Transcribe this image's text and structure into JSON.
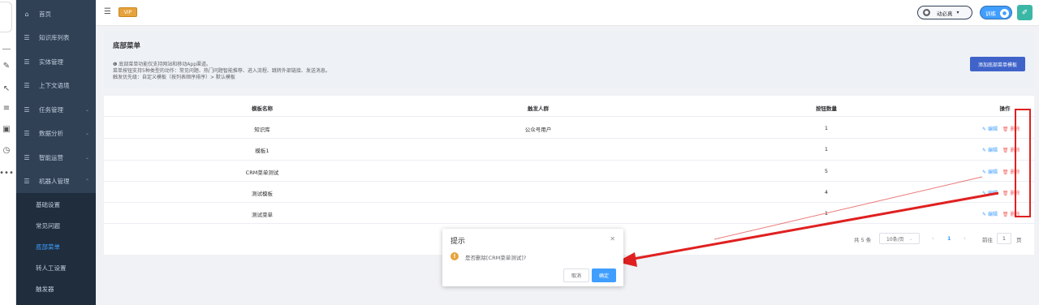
{
  "sidebar": {
    "items": [
      {
        "label": "首页",
        "icon": "home-icon",
        "arrow": ""
      },
      {
        "label": "知识库列表",
        "icon": "list-icon",
        "arrow": ""
      },
      {
        "label": "实体管理",
        "icon": "list-icon",
        "arrow": ""
      },
      {
        "label": "上下文语境",
        "icon": "list-icon",
        "arrow": ""
      },
      {
        "label": "任务管理",
        "icon": "list-icon",
        "arrow": "⌄"
      },
      {
        "label": "数据分析",
        "icon": "list-icon",
        "arrow": "⌄"
      },
      {
        "label": "智能运营",
        "icon": "list-icon",
        "arrow": "⌄"
      },
      {
        "label": "机器人管理",
        "icon": "list-icon",
        "arrow": "⌃"
      }
    ],
    "sub_items": [
      {
        "label": "基础设置"
      },
      {
        "label": "常见问题"
      },
      {
        "label": "底部菜单",
        "active": true
      },
      {
        "label": "转人工设置"
      },
      {
        "label": "触发器"
      }
    ]
  },
  "topbar": {
    "vip_label": "VIP",
    "user_name": "动必真",
    "train_label": "训练"
  },
  "info": {
    "title": "底部菜单",
    "lines": [
      "❶ 底部菜单功能仅支持网站和移动App渠道。",
      "菜单按钮支持5种类型的动作：常见问题、热门问题智能推荐、进入流程、跳转外部链接、发送消息。",
      "触发优先级：自定义模板（按列表顺序排序）> 默认模板"
    ],
    "add_button": "添加底部菜单模板"
  },
  "table": {
    "headers": [
      "模板名称",
      "触发人群",
      "按钮数量",
      "操作"
    ],
    "rows": [
      {
        "name": "知识库",
        "audience": "公众号用户",
        "count": "1"
      },
      {
        "name": "模板1",
        "audience": "",
        "count": "1"
      },
      {
        "name": "CRM菜单测试",
        "audience": "",
        "count": "5"
      },
      {
        "name": "测试模板",
        "audience": "",
        "count": "4"
      },
      {
        "name": "测试菜单",
        "audience": "",
        "count": "1"
      }
    ],
    "edit_label": "编辑",
    "delete_label": "删除"
  },
  "pagination": {
    "total": "共 5 条",
    "page_size": "10条/页",
    "current": "1",
    "goto_label": "前往",
    "goto_value": "1",
    "page_suffix": "页"
  },
  "dialog": {
    "title": "提示",
    "message": "是否删除[CRM菜单测试]?",
    "cancel": "取消",
    "confirm": "确定"
  },
  "colors": {
    "sidebar_bg": "#304156",
    "accent": "#409eff",
    "danger": "#f56c6c",
    "annotation": "#e02020"
  }
}
